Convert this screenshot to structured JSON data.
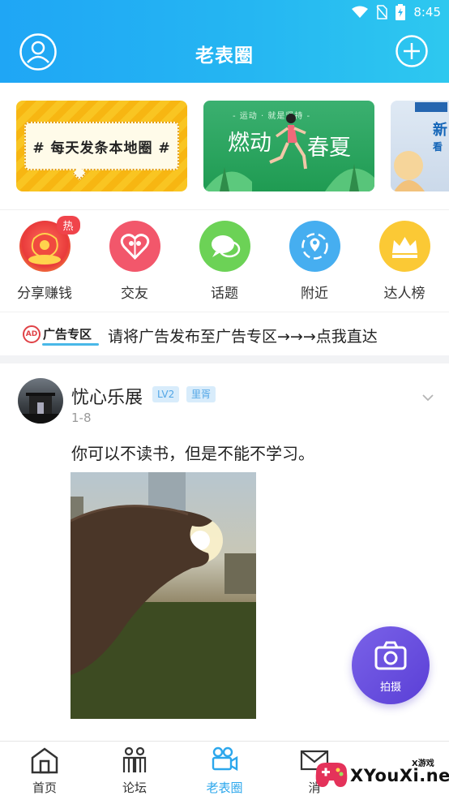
{
  "status_bar": {
    "time": "8:45"
  },
  "header": {
    "title": "老表圈"
  },
  "banners": [
    {
      "text": "# 每天发条本地圈 #"
    },
    {
      "sub": "- 运动 · 就是坚持 -",
      "title_a": "燃动",
      "title_b": "春夏"
    },
    {
      "text": "新",
      "text2": "看"
    }
  ],
  "categories": [
    {
      "label": "分享赚钱",
      "badge": "热"
    },
    {
      "label": "交友"
    },
    {
      "label": "话题"
    },
    {
      "label": "附近"
    },
    {
      "label": "达人榜"
    }
  ],
  "ad": {
    "logo": "AD",
    "tag": "广告专区",
    "text": "请将广告发布至广告专区→→→点我直达"
  },
  "post": {
    "author": "忧心乐展",
    "level": "LV2",
    "tag": "里胥",
    "date": "1-8",
    "content": "你可以不读书，但是不能不学习。"
  },
  "fab": {
    "label": "拍摄"
  },
  "bottom_nav": [
    {
      "label": "首页"
    },
    {
      "label": "论坛"
    },
    {
      "label": "老表圈",
      "active": true
    },
    {
      "label": "消"
    }
  ],
  "watermark": {
    "text": "XYouXi.net",
    "small": "X游戏"
  },
  "colors": {
    "accent": "#2ca7ec",
    "header_start": "#1fa6f5",
    "header_end": "#2ec8ef",
    "fab": "#6a4fe0"
  }
}
